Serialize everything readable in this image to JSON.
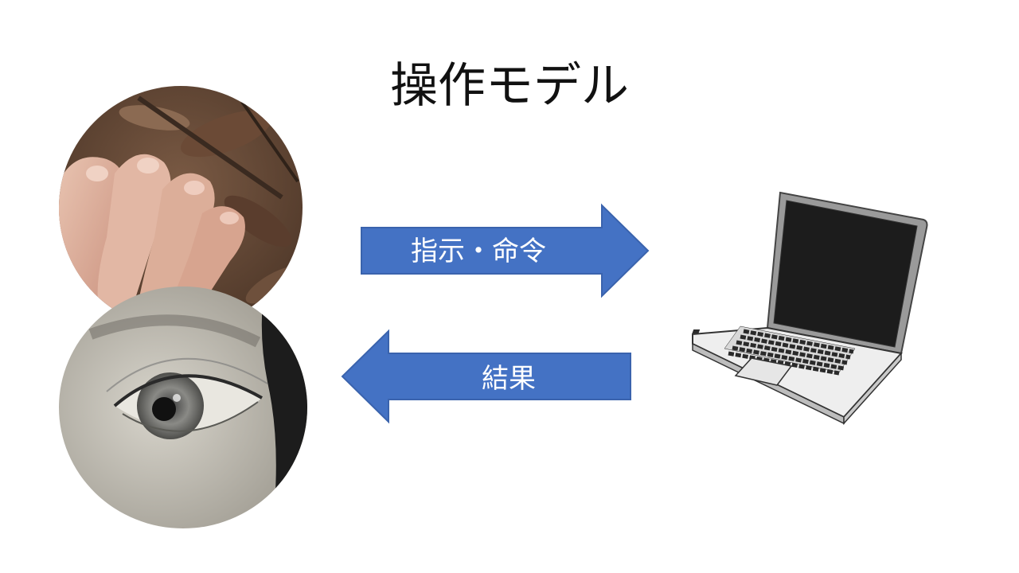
{
  "slide": {
    "title": "操作モデル"
  },
  "arrows": {
    "command_label": "指示・命令",
    "result_label": "結果"
  },
  "colors": {
    "arrow_fill": "#4472c4",
    "arrow_border": "#3a63ad",
    "background": "#ffffff",
    "title_text": "#111111"
  },
  "images": {
    "hand": "hand-photo",
    "eye": "eye-photo",
    "laptop": "laptop-illustration"
  }
}
